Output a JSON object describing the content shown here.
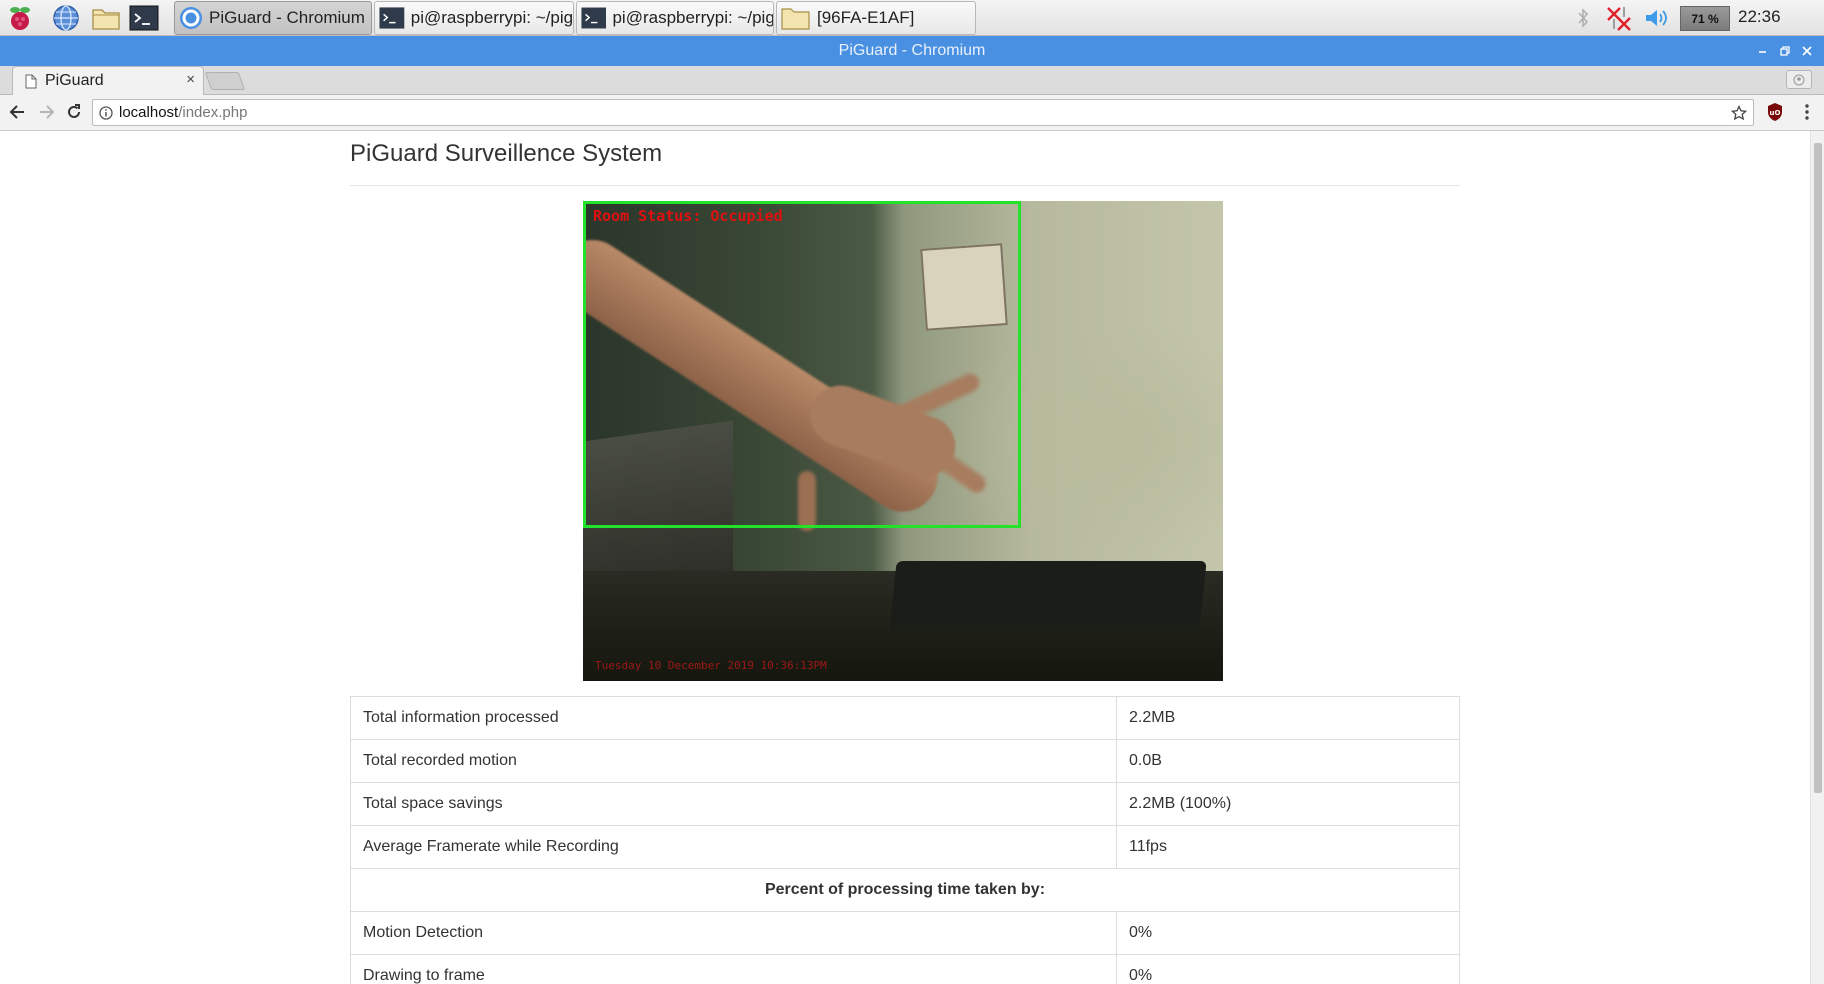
{
  "taskbar": {
    "tasks": [
      {
        "label": "PiGuard - Chromium",
        "active": true
      },
      {
        "label": "pi@raspberrypi: ~/pig..."
      },
      {
        "label": "pi@raspberrypi: ~/pig..."
      },
      {
        "label": "[96FA-E1AF]"
      }
    ],
    "battery": "71 %",
    "clock": "22:36"
  },
  "window": {
    "title": "PiGuard - Chromium"
  },
  "browser": {
    "tab_title": "PiGuard",
    "tab_close": "×",
    "url_host": "localhost",
    "url_path": "/index.php"
  },
  "page": {
    "title": "PiGuard Surveillence System",
    "camera": {
      "status_text": "Room Status: Occupied",
      "timestamp_text": "Tuesday 10 December 2019 10:36:13PM",
      "box_color": "#22e22b",
      "text_color": "#e01010"
    },
    "stats": {
      "rows": [
        {
          "label": "Total information processed",
          "value": "2.2MB"
        },
        {
          "label": "Total recorded motion",
          "value": "0.0B"
        },
        {
          "label": "Total space savings",
          "value": "2.2MB (100%)"
        },
        {
          "label": "Average Framerate while Recording",
          "value": "11fps"
        }
      ],
      "section_heading": "Percent of processing time taken by:",
      "breakdown": [
        {
          "label": "Motion Detection",
          "value": "0%"
        },
        {
          "label": "Drawing to frame",
          "value": "0%"
        }
      ]
    }
  },
  "colors": {
    "titlebar": "#4a90e2",
    "taskbar": "#e8e8e8"
  }
}
